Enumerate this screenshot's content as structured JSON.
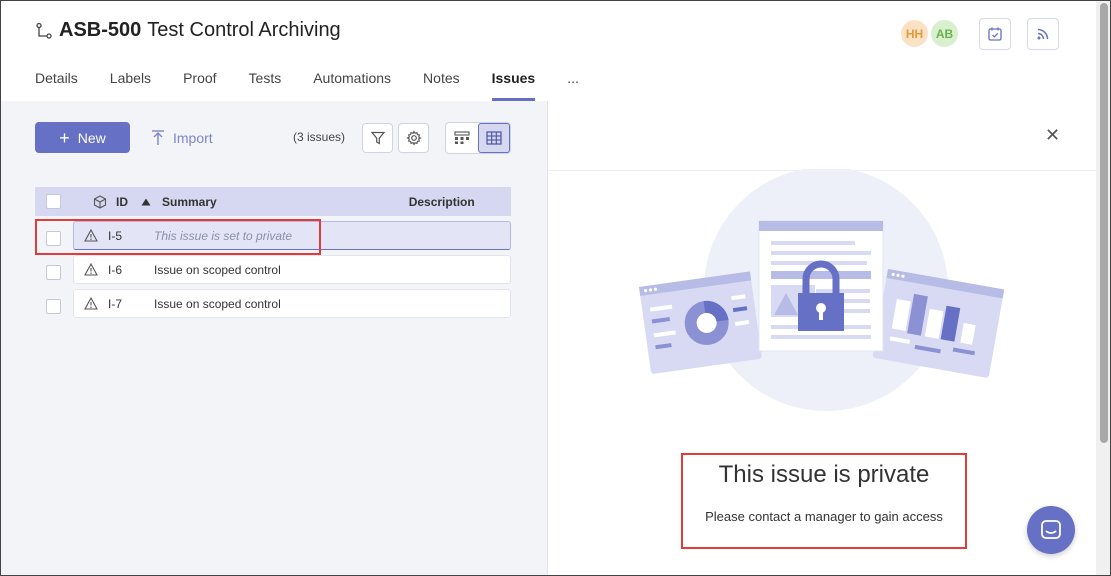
{
  "header": {
    "issue_key": "ASB-500",
    "issue_title": "Test Control Archiving",
    "avatars": [
      {
        "initials": "HH",
        "color": "#e39a3a"
      },
      {
        "initials": "AB",
        "color": "#6ab04c"
      }
    ],
    "buttons": [
      "calendar-check-icon",
      "rss-icon"
    ]
  },
  "tabs": {
    "items": [
      {
        "label": "Details"
      },
      {
        "label": "Labels"
      },
      {
        "label": "Proof"
      },
      {
        "label": "Tests"
      },
      {
        "label": "Automations"
      },
      {
        "label": "Notes"
      },
      {
        "label": "Issues",
        "active": true
      }
    ],
    "more": "..."
  },
  "toolbar": {
    "new_label": "New",
    "import_label": "Import",
    "issue_count": "(3 issues)"
  },
  "table": {
    "columns": {
      "id": "ID",
      "summary": "Summary",
      "description": "Description"
    },
    "rows": [
      {
        "id": "I-5",
        "summary": "This issue is set to private",
        "private": true,
        "selected": true
      },
      {
        "id": "I-6",
        "summary": "Issue on scoped control",
        "private": false
      },
      {
        "id": "I-7",
        "summary": "Issue on scoped control",
        "private": false
      }
    ]
  },
  "detail": {
    "title": "This issue is private",
    "message": "Please contact a manager to gain access"
  },
  "colors": {
    "accent": "#6670c4",
    "highlight": "#e03c3c",
    "table_header": "#d6d8f2"
  }
}
